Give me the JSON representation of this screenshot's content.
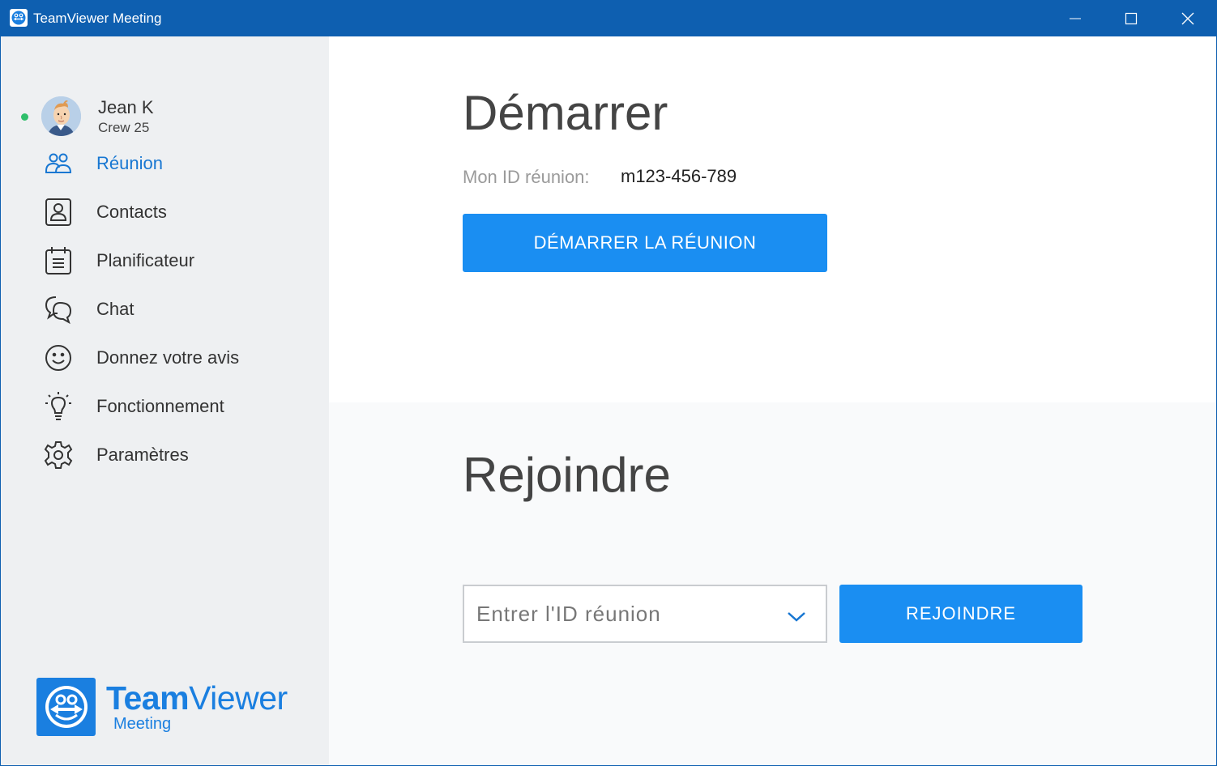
{
  "window": {
    "title": "TeamViewer Meeting",
    "accent_color": "#0e5fb0"
  },
  "user": {
    "name": "Jean K",
    "subtitle": "Crew 25",
    "status": "online",
    "status_color": "#2fbf6b"
  },
  "sidebar": {
    "items": [
      {
        "label": "Réunion",
        "icon": "people-icon",
        "active": true
      },
      {
        "label": "Contacts",
        "icon": "contact-card-icon",
        "active": false
      },
      {
        "label": "Planificateur",
        "icon": "calendar-icon",
        "active": false
      },
      {
        "label": "Chat",
        "icon": "chat-bubbles-icon",
        "active": false
      },
      {
        "label": "Donnez votre avis",
        "icon": "smiley-icon",
        "active": false
      },
      {
        "label": "Fonctionnement",
        "icon": "lightbulb-icon",
        "active": false
      },
      {
        "label": "Paramètres",
        "icon": "gear-icon",
        "active": false
      }
    ],
    "active_color": "#1877d2"
  },
  "brand": {
    "name_bold": "Team",
    "name_regular": "Viewer",
    "product": "Meeting",
    "color": "#1a7fe0"
  },
  "start": {
    "heading": "Démarrer",
    "id_label": "Mon ID réunion:",
    "id_value": "m123-456-789",
    "button_label": "DÉMARRER LA RÉUNION",
    "button_color": "#1a8ef2"
  },
  "join": {
    "heading": "Rejoindre",
    "input_placeholder": "Entrer l'ID réunion",
    "input_value": "",
    "button_label": "REJOINDRE",
    "button_color": "#1a8ef2"
  }
}
